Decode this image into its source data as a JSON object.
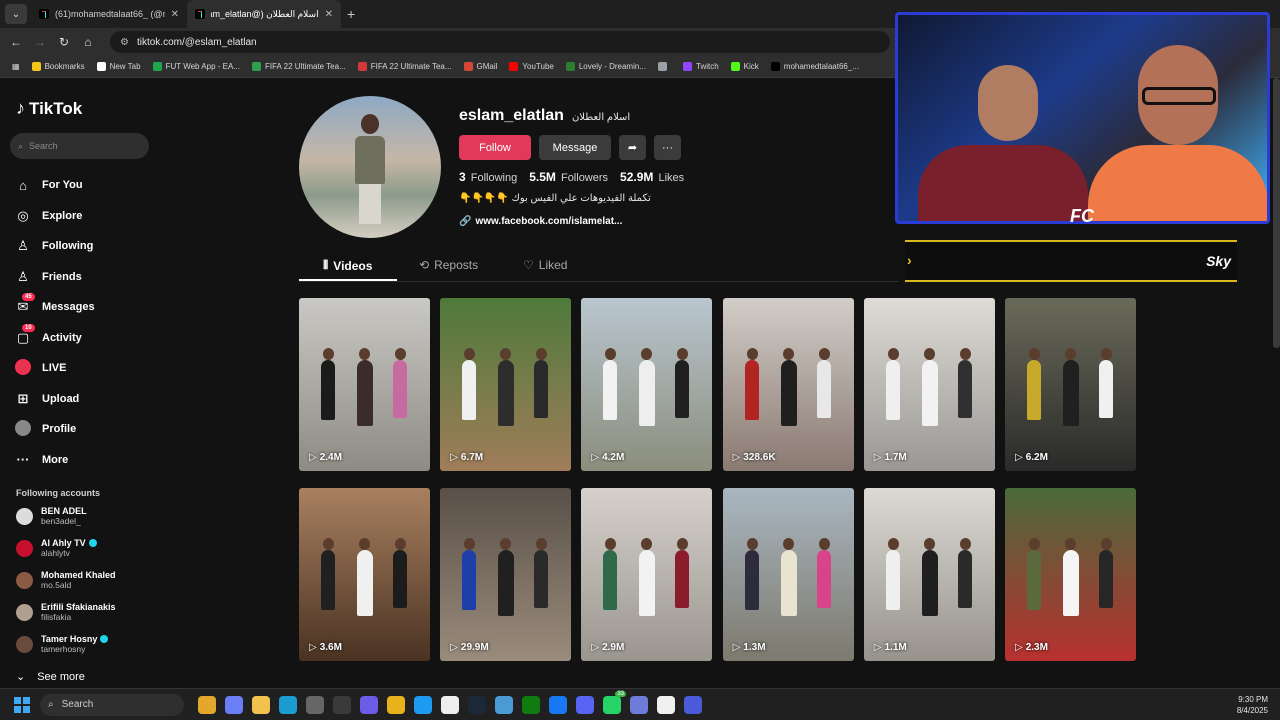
{
  "browser": {
    "tabs": [
      {
        "title": "(61)mohamedtalaat66_ (@mohe",
        "close": "✕"
      },
      {
        "title": "اسلام العطلان (@eslam_elatlan) (61)",
        "close": "✕"
      }
    ],
    "new_tab": "+",
    "url": "tiktok.com/@eslam_elatlan",
    "bookmarks": [
      {
        "label": "Bookmarks",
        "color": "#f5c518"
      },
      {
        "label": "New Tab",
        "color": "#ffffff"
      },
      {
        "label": "FUT Web App - EA...",
        "color": "#1fa64a"
      },
      {
        "label": "FIFA 22 Ultimate Tea...",
        "color": "#2f9f4f"
      },
      {
        "label": "FIFA 22 Ultimate Tea...",
        "color": "#d33838"
      },
      {
        "label": "GMail",
        "color": "#d44638"
      },
      {
        "label": "YouTube",
        "color": "#ff0000"
      },
      {
        "label": "Lovely - Dreamin...",
        "color": "#2c7d30"
      },
      {
        "label": "",
        "color": "#9aa0a6"
      },
      {
        "label": "Twitch",
        "color": "#9146ff"
      },
      {
        "label": "Kick",
        "color": "#53fc18"
      },
      {
        "label": "mohamedtalaat66_...",
        "color": "#000000"
      }
    ]
  },
  "sidebar": {
    "logo": "TikTok",
    "search_placeholder": "Search",
    "nav": [
      {
        "label": "For You",
        "icon": "home-icon",
        "glyph": "⌂"
      },
      {
        "label": "Explore",
        "icon": "compass-icon",
        "glyph": "◎"
      },
      {
        "label": "Following",
        "icon": "user-plus-icon",
        "glyph": "♙"
      },
      {
        "label": "Friends",
        "icon": "friends-icon",
        "glyph": "♙"
      },
      {
        "label": "Messages",
        "icon": "messages-icon",
        "glyph": "✉",
        "badge": "45"
      },
      {
        "label": "Activity",
        "icon": "bell-icon",
        "glyph": "▢",
        "badge": "10"
      },
      {
        "label": "LIVE",
        "icon": "live-icon",
        "glyph": ""
      },
      {
        "label": "Upload",
        "icon": "upload-icon",
        "glyph": "⊞"
      },
      {
        "label": "Profile",
        "icon": "profile-icon",
        "glyph": ""
      },
      {
        "label": "More",
        "icon": "more-icon",
        "glyph": "···"
      }
    ],
    "following_header": "Following accounts",
    "accounts": [
      {
        "name": "BEN ADEL",
        "handle": "ben3adel_",
        "verified": false,
        "color": "#dcdcdc"
      },
      {
        "name": "Al Ahly TV",
        "handle": "alahlytv",
        "verified": true,
        "color": "#c8102e"
      },
      {
        "name": "Mohamed Khaled",
        "handle": "mo.5ald",
        "verified": false,
        "color": "#8a5a44"
      },
      {
        "name": "Erifili Sfakianakis",
        "handle": "filisfakia",
        "verified": false,
        "color": "#b0a090"
      },
      {
        "name": "Tamer Hosny",
        "handle": "tamerhosny",
        "verified": true,
        "color": "#6a4a3a"
      }
    ],
    "see_more": "See more"
  },
  "profile": {
    "username": "eslam_elatlan",
    "display_name": "اسلام العطلان",
    "follow_label": "Follow",
    "message_label": "Message",
    "following_count": "3",
    "following_label": "Following",
    "followers_count": "5.5M",
    "followers_label": "Followers",
    "likes_count": "52.9M",
    "likes_label": "Likes",
    "bio": "تكملة الفيديوهات علي الفيس بوك 👇👇👇👇",
    "link": "www.facebook.com/islamelat..."
  },
  "content_tabs": [
    {
      "label": "Videos",
      "active": true
    },
    {
      "label": "Reposts",
      "active": false
    },
    {
      "label": "Liked",
      "active": false
    }
  ],
  "videos": [
    {
      "views": "2.4M",
      "bg1": "#c9c8c4",
      "bg2": "#8d8b83",
      "c1": "#1b1b1b",
      "c2": "#3b2b2b",
      "c3": "#c86aa0"
    },
    {
      "views": "6.7M",
      "bg1": "#4e7a3a",
      "bg2": "#a07d5a",
      "c1": "#f0f0f0",
      "c2": "#2d2d2d",
      "c3": "#2a2a2a"
    },
    {
      "views": "4.2M",
      "bg1": "#b9c6cf",
      "bg2": "#8b8e7d",
      "c1": "#f2f2f2",
      "c2": "#eeeeee",
      "c3": "#202020"
    },
    {
      "views": "328.6K",
      "bg1": "#d2cdc8",
      "bg2": "#8a7a72",
      "c1": "#b22424",
      "c2": "#1f1f1f",
      "c3": "#e8e8e8"
    },
    {
      "views": "1.7M",
      "bg1": "#dedbd6",
      "bg2": "#9a9894",
      "c1": "#efefef",
      "c2": "#f2f2f2",
      "c3": "#303030"
    },
    {
      "views": "6.2M",
      "bg1": "#6a6a5a",
      "bg2": "#2a2a2a",
      "c1": "#c9a92a",
      "c2": "#202020",
      "c3": "#f0f0f0"
    },
    {
      "views": "3.6M",
      "bg1": "#a88060",
      "bg2": "#4a3222",
      "c1": "#202020",
      "c2": "#f0f0f0",
      "c3": "#1c1c1c"
    },
    {
      "views": "29.9M",
      "bg1": "#5a5048",
      "bg2": "#9a8c7c",
      "c1": "#1e3ea8",
      "c2": "#202020",
      "c3": "#2a2a2a"
    },
    {
      "views": "2.9M",
      "bg1": "#d5d0cb",
      "bg2": "#9a968f",
      "c1": "#2e6a4a",
      "c2": "#f2f2f2",
      "c3": "#8a1c2c"
    },
    {
      "views": "1.3M",
      "bg1": "#a9b6c0",
      "bg2": "#7d7a6e",
      "c1": "#2c2c3c",
      "c2": "#e9e4d0",
      "c3": "#d8448a"
    },
    {
      "views": "1.1M",
      "bg1": "#dcd8d3",
      "bg2": "#97938c",
      "c1": "#efefef",
      "c2": "#1f1f1f",
      "c3": "#2a2a2a"
    },
    {
      "views": "2.3M",
      "bg1": "#4a6a3a",
      "bg2": "#b83030",
      "c1": "#5a6a3c",
      "c2": "#f5f5f5",
      "c3": "#262626"
    }
  ],
  "overlay": {
    "banner_text": "Sky",
    "cam_logo": "FC"
  },
  "taskbar": {
    "search": "Search",
    "time": "9:30 PM",
    "date": "8/4/2025",
    "apps": [
      {
        "icon": "file-explorer-icon",
        "color": "#e3a82b"
      },
      {
        "icon": "copilot-icon",
        "color": "#6a7ef5"
      },
      {
        "icon": "folder-icon",
        "color": "#f2c14e"
      },
      {
        "icon": "edge-icon",
        "color": "#1c9bd1"
      },
      {
        "icon": "store-icon",
        "color": "#666666"
      },
      {
        "icon": "app-icon",
        "color": "#3a3a3a"
      },
      {
        "icon": "obs-icon",
        "color": "#6c5ce7"
      },
      {
        "icon": "chrome-icon",
        "color": "#e8b21c"
      },
      {
        "icon": "twitter-icon",
        "color": "#1d9bf0"
      },
      {
        "icon": "notion-icon",
        "color": "#eeeeee"
      },
      {
        "icon": "steam-icon",
        "color": "#1b2838"
      },
      {
        "icon": "monitor-icon",
        "color": "#4a9ad4"
      },
      {
        "icon": "xbox-icon",
        "color": "#107c10"
      },
      {
        "icon": "facebook-icon",
        "color": "#1877f2"
      },
      {
        "icon": "discord-icon",
        "color": "#5865f2"
      },
      {
        "icon": "whatsapp-icon",
        "color": "#25d366",
        "badge": "33"
      },
      {
        "icon": "vpn-icon",
        "color": "#6d7bd9"
      },
      {
        "icon": "capcut-icon",
        "color": "#f0f0f0"
      },
      {
        "icon": "settings-icon",
        "color": "#4a5ad8"
      }
    ]
  }
}
